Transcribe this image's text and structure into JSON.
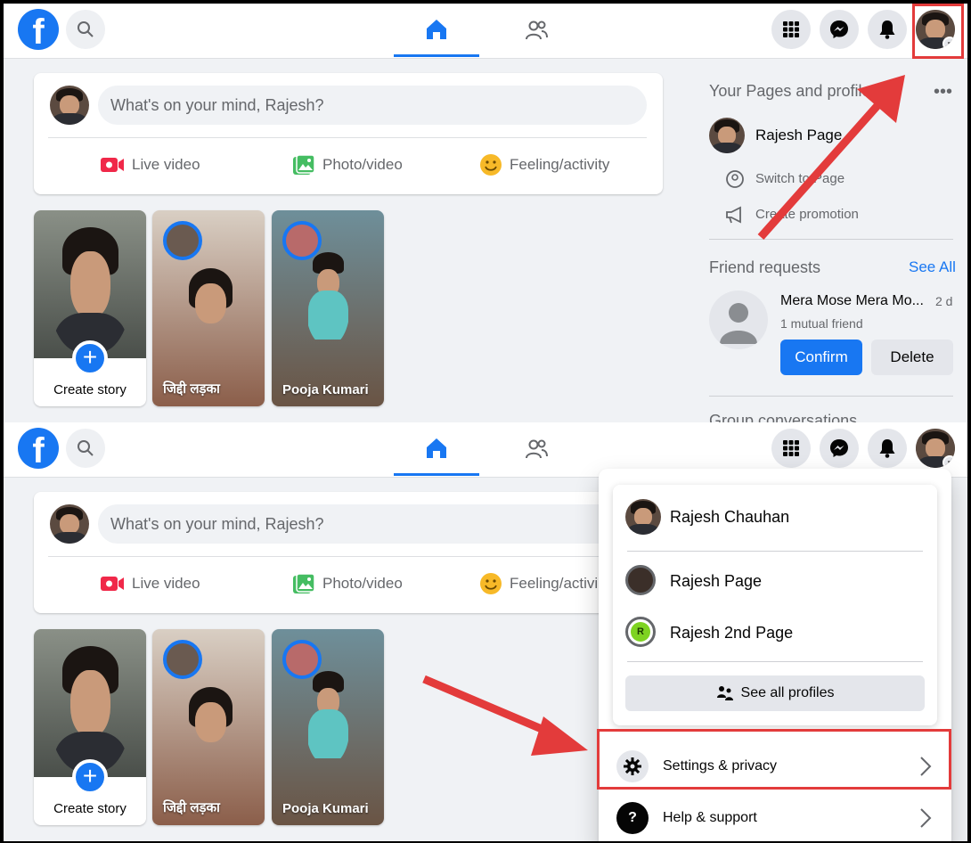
{
  "top": {
    "composer": {
      "placeholder": "What's on your mind, Rajesh?",
      "live_video": "Live video",
      "photo_video": "Photo/video",
      "feeling_activity": "Feeling/activity"
    },
    "stories": {
      "create": "Create story",
      "story1_name": "जिद्दी लड़का",
      "story2_name": "Pooja Kumari"
    },
    "sidebar": {
      "pages_title": "Your Pages and profiles",
      "page_name": "Rajesh Page",
      "switch_page": "Switch to Page",
      "create_promotion": "Create promotion",
      "friend_requests_title": "Friend requests",
      "see_all": "See All",
      "request_name": "Mera Mose Mera Mo...",
      "request_time": "2 d",
      "mutual": "1 mutual friend",
      "confirm": "Confirm",
      "delete": "Delete",
      "group_conversations": "Group conversations"
    }
  },
  "bottom": {
    "composer": {
      "placeholder": "What's on your mind, Rajesh?",
      "live_video": "Live video",
      "photo_video": "Photo/video",
      "feeling_activity": "Feeling/activi"
    },
    "stories": {
      "create": "Create story",
      "story1_name": "जिद्दी लड़का",
      "story2_name": "Pooja Kumari"
    },
    "menu": {
      "profile_name": "Rajesh Chauhan",
      "page1": "Rajesh Page",
      "page2": "Rajesh 2nd Page",
      "page2_initial": "R",
      "see_all_profiles": "See all profiles",
      "settings_privacy": "Settings & privacy",
      "help_support": "Help & support"
    }
  },
  "colors": {
    "brand_blue": "#1877f2",
    "annotation_red": "#e33b3b"
  }
}
